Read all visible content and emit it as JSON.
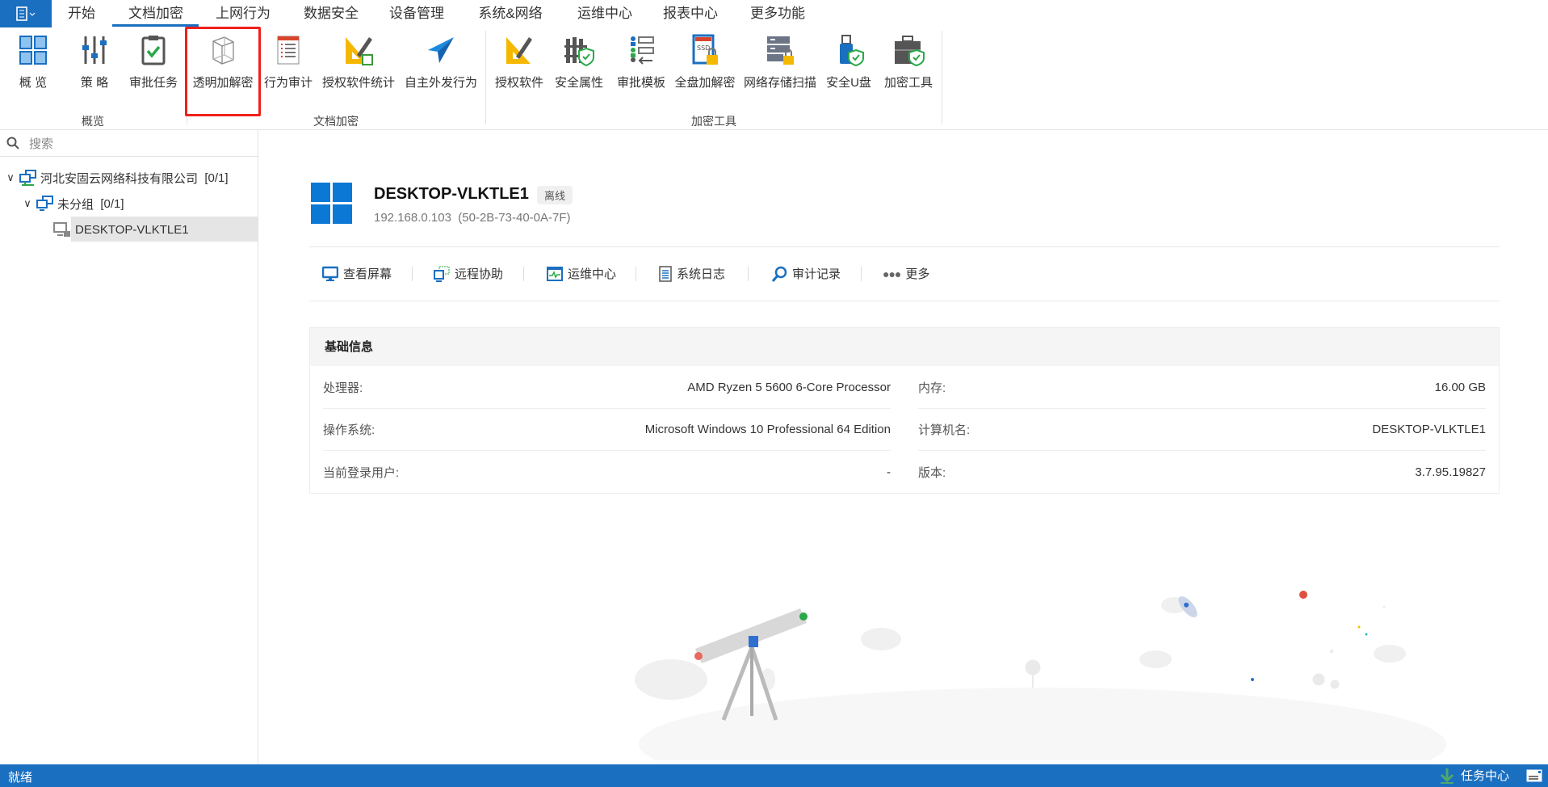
{
  "menu": {
    "tabs": [
      "开始",
      "文档加密",
      "上网行为",
      "数据安全",
      "设备管理",
      "系统&网络",
      "运维中心",
      "报表中心",
      "更多功能"
    ],
    "active": "文档加密"
  },
  "ribbon": {
    "items": [
      "概 览",
      "策 略",
      "审批任务",
      "透明加解密",
      "行为审计",
      "授权软件统计",
      "自主外发行为",
      "授权软件",
      "安全属性",
      "审批模板",
      "全盘加解密",
      "网络存储扫描",
      "安全U盘",
      "加密工具"
    ],
    "groups": [
      "概览",
      "文档加密",
      "加密工具"
    ],
    "highlighted": "透明加解密"
  },
  "sidebar": {
    "search_placeholder": "搜索",
    "tree": [
      {
        "label": "河北安固云网络科技有限公司",
        "count": "[0/1]"
      },
      {
        "label": "未分组",
        "count": "[0/1]"
      },
      {
        "label": "DESKTOP-VLKTLE1"
      }
    ]
  },
  "device": {
    "name": "DESKTOP-VLKTLE1",
    "status": "离线",
    "ip": "192.168.0.103",
    "mac": "(50-2B-73-40-0A-7F)"
  },
  "actions": [
    "查看屏幕",
    "远程协助",
    "运维中心",
    "系统日志",
    "审计记录",
    "更多"
  ],
  "info": {
    "title": "基础信息",
    "rows": [
      {
        "l1": "处理器:",
        "v1": "AMD Ryzen 5 5600 6-Core Processor",
        "l2": "内存:",
        "v2": "16.00 GB"
      },
      {
        "l1": "操作系统:",
        "v1": "Microsoft Windows 10 Professional 64 Edition",
        "l2": "计算机名:",
        "v2": "DESKTOP-VLKTLE1"
      },
      {
        "l1": "当前登录用户:",
        "v1": "-",
        "l2": "版本:",
        "v2": "3.7.95.19827"
      }
    ]
  },
  "statusbar": {
    "left": "就绪",
    "task_center": "任务中心"
  },
  "colors": {
    "brand": "#1a6fc0",
    "highlight": "#f0201c",
    "offline_badge": "#f0f0f0"
  }
}
